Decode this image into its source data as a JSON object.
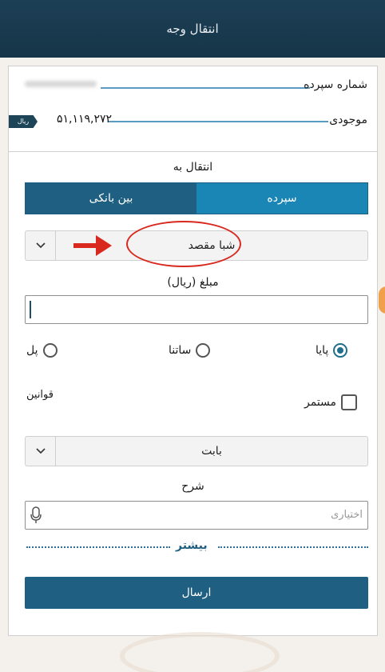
{
  "header": {
    "title": "انتقال وجه"
  },
  "account": {
    "deposit_number_label": "شماره سپرده",
    "balance_label": "موجودی",
    "balance_value": "۵۱,۱۱۹,۲۷۲",
    "currency_badge": "ریال"
  },
  "transfer": {
    "section_title": "انتقال به",
    "tabs": [
      {
        "label": "سپرده",
        "active": true
      },
      {
        "label": "بین بانکی",
        "active": false
      }
    ],
    "destination_select": {
      "value": "شبا مقصد"
    },
    "amount_label": "مبلغ (ریال)",
    "amount_value": "",
    "methods": [
      {
        "label": "پایا",
        "checked": true
      },
      {
        "label": "ساتنا",
        "checked": false
      },
      {
        "label": "پل",
        "checked": false
      }
    ],
    "recurring_label": "مستمر",
    "rules_link": "قوانین",
    "reason_select": {
      "value": "بابت"
    },
    "description_label": "شرح",
    "description_placeholder": "اختیاری",
    "more_label": "بیشتر",
    "submit_label": "ارسال"
  },
  "icons": {
    "chevron": "chevron-down-icon",
    "mic": "microphone-icon"
  },
  "colors": {
    "header_bg": "#1d3f55",
    "primary": "#1f5f82",
    "tab_active": "#1a86b5",
    "annotation_red": "#d9281e"
  }
}
